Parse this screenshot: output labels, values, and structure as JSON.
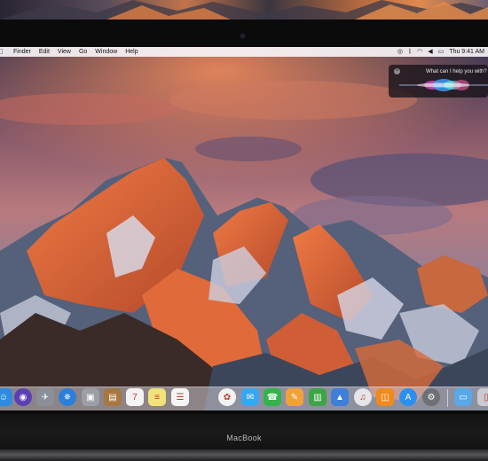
{
  "device": {
    "label": "MacBook"
  },
  "menubar": {
    "apple_glyph": "",
    "items": [
      "Finder",
      "Edit",
      "View",
      "Go",
      "Window",
      "Help"
    ],
    "status_icons": [
      "siri-icon",
      "bluetooth-icon",
      "wifi-icon",
      "volume-icon",
      "battery-icon"
    ],
    "clock": "Thu 9:41 AM"
  },
  "siri": {
    "prompt": "What can I help you with?",
    "close_glyph": "×"
  },
  "dock": {
    "items": [
      {
        "name": "finder-icon",
        "glyph": "☺",
        "color": "#2f8be0"
      },
      {
        "name": "siri-icon",
        "glyph": "◉",
        "color": "#5b3fb3"
      },
      {
        "name": "launchpad-icon",
        "glyph": "✈",
        "color": "#8a8f99"
      },
      {
        "name": "safari-icon",
        "glyph": "✵",
        "color": "#2a7fdb"
      },
      {
        "name": "photo-booth-icon",
        "glyph": "▣",
        "color": "#9a9fa8"
      },
      {
        "name": "contacts-icon",
        "glyph": "▤",
        "color": "#a8773f"
      },
      {
        "name": "calendar-icon",
        "glyph": "7",
        "color": "#f3f3f3"
      },
      {
        "name": "notes-icon",
        "glyph": "≡",
        "color": "#f2e27a"
      },
      {
        "name": "reminders-icon",
        "glyph": "☰",
        "color": "#f5f5f5"
      },
      {
        "name": "photos-icon",
        "glyph": "✿",
        "color": "#f2f2f2"
      },
      {
        "name": "messages-icon",
        "glyph": "✉",
        "color": "#38a6f2"
      },
      {
        "name": "facetime-icon",
        "glyph": "☎",
        "color": "#35b24a"
      },
      {
        "name": "pages-icon",
        "glyph": "✎",
        "color": "#f2a13a"
      },
      {
        "name": "numbers-icon",
        "glyph": "▥",
        "color": "#3da447"
      },
      {
        "name": "keynote-icon",
        "glyph": "▲",
        "color": "#3f7fd9"
      },
      {
        "name": "itunes-icon",
        "glyph": "♫",
        "color": "#e5e5ea"
      },
      {
        "name": "ibooks-icon",
        "glyph": "◫",
        "color": "#f08a1c"
      },
      {
        "name": "app-store-icon",
        "glyph": "A",
        "color": "#2b8ef0"
      },
      {
        "name": "system-preferences-icon",
        "glyph": "⚙",
        "color": "#6e7075"
      },
      {
        "name": "downloads-folder-icon",
        "glyph": "▭",
        "color": "#5aa8e8"
      },
      {
        "name": "trash-icon",
        "glyph": "▯",
        "color": "#c9cbd0"
      }
    ]
  },
  "colors": {
    "sky_top": "#3b3650",
    "sky_mid": "#b25a55",
    "sky_glow": "#e58a5a",
    "mountain_lit": "#e0643a",
    "mountain_shadow": "#384458",
    "snow": "#d7d8e6"
  }
}
